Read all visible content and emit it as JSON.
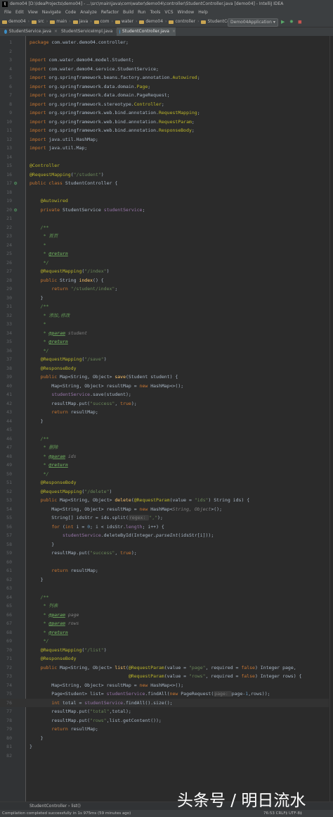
{
  "window": {
    "title": "demo04 [D:\\IdeaProjects\\demo04] - ...\\src\\main\\java\\com\\water\\demo04\\controller\\StudentController.java [demo04] - IntelliJ IDEA",
    "app_icon": "IJ"
  },
  "menu": [
    "File",
    "Edit",
    "View",
    "Navigate",
    "Code",
    "Analyze",
    "Refactor",
    "Build",
    "Run",
    "Tools",
    "VCS",
    "Window",
    "Help"
  ],
  "breadcrumbs": [
    "demo04",
    "src",
    "main",
    "java",
    "com",
    "water",
    "demo04",
    "controller",
    "StudentController"
  ],
  "toolbar": {
    "run_config": "Demo04Application ▾",
    "run_icon": "▶",
    "debug_icon": "✹",
    "coverage_icon": "◼"
  },
  "tabs": [
    {
      "label": "StudentService.java",
      "active": false
    },
    {
      "label": "StudentServiceImpl.java",
      "active": false
    },
    {
      "label": "StudentController.java",
      "active": true
    }
  ],
  "lines": [
    {
      "n": "1",
      "html": "<span class='kw'>package</span> com.water.demo04.controller;"
    },
    {
      "n": "2",
      "html": ""
    },
    {
      "n": "3",
      "html": "<span class='kw'>import</span> com.water.demo04.model.Student;"
    },
    {
      "n": "4",
      "html": "<span class='kw'>import</span> com.water.demo04.service.StudentService;"
    },
    {
      "n": "5",
      "html": "<span class='kw'>import</span> org.springframework.beans.factory.annotation.<span class='an'>Autowired</span>;"
    },
    {
      "n": "6",
      "html": "<span class='kw'>import</span> org.springframework.data.domain.<span class='an'>Page</span>;"
    },
    {
      "n": "7",
      "html": "<span class='kw'>import</span> org.springframework.data.domain.PageRequest;"
    },
    {
      "n": "8",
      "html": "<span class='kw'>import</span> org.springframework.stereotype.<span class='an'>Controller</span>;"
    },
    {
      "n": "9",
      "html": "<span class='kw'>import</span> org.springframework.web.bind.annotation.<span class='an'>RequestMapping</span>;"
    },
    {
      "n": "10",
      "html": "<span class='kw'>import</span> org.springframework.web.bind.annotation.<span class='an'>RequestParam</span>;"
    },
    {
      "n": "11",
      "html": "<span class='kw'>import</span> org.springframework.web.bind.annotation.<span class='an'>ResponseBody</span>;"
    },
    {
      "n": "12",
      "html": "<span class='kw'>import</span> java.util.HashMap;"
    },
    {
      "n": "13",
      "html": "<span class='kw'>import</span> java.util.Map;"
    },
    {
      "n": "14",
      "html": ""
    },
    {
      "n": "15",
      "html": "<span class='an'>@Controller</span>"
    },
    {
      "n": "16",
      "html": "<span class='an'>@RequestMapping</span>(<span class='st'>\"/student\"</span>)"
    },
    {
      "n": "17",
      "html": "<span class='kw'>public class</span> StudentController {",
      "gi": "bean"
    },
    {
      "n": "18",
      "html": ""
    },
    {
      "n": "19",
      "html": "    <span class='an'>@Autowired</span>"
    },
    {
      "n": "20",
      "html": "    <span class='kw'>private</span> StudentService <span class='fd'>studentService</span>;",
      "gi": "bean"
    },
    {
      "n": "21",
      "html": ""
    },
    {
      "n": "22",
      "html": "    <span class='cm'>/**</span>"
    },
    {
      "n": "23",
      "html": "    <span class='cm'> * 首页</span>"
    },
    {
      "n": "24",
      "html": "    <span class='cm'> *</span>"
    },
    {
      "n": "25",
      "html": "    <span class='cm'> * </span><span class='tag'>@return</span>"
    },
    {
      "n": "26",
      "html": "    <span class='cm'> */</span>"
    },
    {
      "n": "27",
      "html": "    <span class='an'>@RequestMapping</span>(<span class='st'>\"/index\"</span>)"
    },
    {
      "n": "28",
      "html": "    <span class='kw'>public</span> String <span class='fn'>index</span>() {"
    },
    {
      "n": "29",
      "html": "        <span class='kw'>return</span> <span class='st'>\"/student/index\"</span>;"
    },
    {
      "n": "30",
      "html": "    }"
    },
    {
      "n": "31",
      "html": "    <span class='cm'>/**</span>"
    },
    {
      "n": "32",
      "html": "    <span class='cm'> * 添加,修改</span>"
    },
    {
      "n": "33",
      "html": "    <span class='cm'> *</span>"
    },
    {
      "n": "34",
      "html": "    <span class='cm'> * </span><span class='tag'>@param</span> <span class='pn'>student</span>"
    },
    {
      "n": "35",
      "html": "    <span class='cm'> * </span><span class='tag'>@return</span>"
    },
    {
      "n": "36",
      "html": "    <span class='cm'> */</span>"
    },
    {
      "n": "37",
      "html": "    <span class='an'>@RequestMapping</span>(<span class='st'>\"/save\"</span>)"
    },
    {
      "n": "38",
      "html": "    <span class='an'>@ResponseBody</span>"
    },
    {
      "n": "39",
      "html": "    <span class='kw'>public</span> Map&lt;String, Object&gt; <span class='fn'>save</span>(Student student) {"
    },
    {
      "n": "40",
      "html": "        Map&lt;String, Object&gt; resultMap = <span class='kw'>new</span> HashMap&lt;&gt;();"
    },
    {
      "n": "41",
      "html": "        <span class='fd'>studentService</span>.save(student);"
    },
    {
      "n": "42",
      "html": "        resultMap.put(<span class='st'>\"success\"</span>, <span class='kw'>true</span>);"
    },
    {
      "n": "43",
      "html": "        <span class='kw'>return</span> resultMap;"
    },
    {
      "n": "44",
      "html": "    }"
    },
    {
      "n": "45",
      "html": ""
    },
    {
      "n": "46",
      "html": "    <span class='cm'>/**</span>"
    },
    {
      "n": "47",
      "html": "    <span class='cm'> * 删除</span>"
    },
    {
      "n": "48",
      "html": "    <span class='cm'> * </span><span class='tag'>@param</span> <span class='pn'>ids</span>"
    },
    {
      "n": "49",
      "html": "    <span class='cm'> * </span><span class='tag'>@return</span>"
    },
    {
      "n": "50",
      "html": "    <span class='cm'> */</span>"
    },
    {
      "n": "51",
      "html": "    <span class='an'>@ResponseBody</span>"
    },
    {
      "n": "52",
      "html": "    <span class='an'>@RequestMapping</span>(<span class='st'>\"/delete\"</span>)"
    },
    {
      "n": "53",
      "html": "    <span class='kw'>public</span> Map&lt;String, Object&gt; <span class='fn'>delete</span>(<span class='an'>@RequestParam</span>(value = <span class='st'>\"ids\"</span>) String ids) {"
    },
    {
      "n": "54",
      "html": "        Map&lt;String, Object&gt; resultMap = <span class='kw'>new</span> HashMap&lt;<span class='pn'>String, Object</span>&gt;();"
    },
    {
      "n": "55",
      "html": "        String[] idsStr = ids.split(<span class='hint'>regex: </span><span class='st'>\",\"</span>);"
    },
    {
      "n": "56",
      "html": "        <span class='kw'>for</span> (<span class='kw'>int</span> i = <span class='nm'>0</span>; i &lt; idsStr.<span class='fd'>length</span>; i++) {"
    },
    {
      "n": "57",
      "html": "            <span class='fd'>studentService</span>.deleteById(Integer.<span class='sm'>parseInt</span>(idsStr[i]));"
    },
    {
      "n": "58",
      "html": "        }"
    },
    {
      "n": "59",
      "html": "        resultMap.put(<span class='st'>\"success\"</span>, <span class='kw'>true</span>);"
    },
    {
      "n": "60",
      "html": ""
    },
    {
      "n": "61",
      "html": "        <span class='kw'>return</span> resultMap;"
    },
    {
      "n": "62",
      "html": "    }"
    },
    {
      "n": "63",
      "html": ""
    },
    {
      "n": "64",
      "html": "    <span class='cm'>/**</span>"
    },
    {
      "n": "65",
      "html": "    <span class='cm'> * 列表</span>"
    },
    {
      "n": "66",
      "html": "    <span class='cm'> * </span><span class='tag'>@param</span> <span class='pn'>page</span>"
    },
    {
      "n": "67",
      "html": "    <span class='cm'> * </span><span class='tag'>@param</span> <span class='pn'>rows</span>"
    },
    {
      "n": "68",
      "html": "    <span class='cm'> * </span><span class='tag'>@return</span>"
    },
    {
      "n": "69",
      "html": "    <span class='cm'> */</span>"
    },
    {
      "n": "70",
      "html": "    <span class='an'>@RequestMapping</span>(<span class='st'>\"/list\"</span>)"
    },
    {
      "n": "71",
      "html": "    <span class='an'>@ResponseBody</span>"
    },
    {
      "n": "72",
      "html": "    <span class='kw'>public</span> Map&lt;String, Object&gt; <span class='fn'>list</span>(<span class='an'>@RequestParam</span>(value = <span class='st'>\"page\"</span>, required = <span class='kw'>false</span>) Integer page,"
    },
    {
      "n": "73",
      "html": "                                    <span class='an'>@RequestParam</span>(value = <span class='st'>\"rows\"</span>, required = <span class='kw'>false</span>) Integer rows) {"
    },
    {
      "n": "74",
      "html": "        Map&lt;String, Object&gt; resultMap = <span class='kw'>new</span> HashMap&lt;&gt;();"
    },
    {
      "n": "75",
      "html": "        Page&lt;Student&gt; list= <span class='fd'>studentService</span>.findAll(<span class='kw'>new</span> PageRequest(<span class='hint'>page: </span>page-<span class='nm'>1</span>,rows));"
    },
    {
      "n": "76",
      "html": "        <span class='kw'>int</span> total = <span class='fd'>studentService</span>.findAll().size();",
      "hl": true
    },
    {
      "n": "77",
      "html": "        resultMap.put(<span class='st'>\"total\"</span>,total);"
    },
    {
      "n": "78",
      "html": "        resultMap.put(<span class='st'>\"rows\"</span>,list.getContent());"
    },
    {
      "n": "79",
      "html": "        <span class='kw'>return</span> resultMap;"
    },
    {
      "n": "80",
      "html": "    }"
    },
    {
      "n": "81",
      "html": "}"
    },
    {
      "n": "82",
      "html": ""
    }
  ],
  "footer_breadcrumb": "StudentController  ›  list()",
  "status": {
    "message": "Compilation completed successfully in 1s 975ms (59 minutes ago)",
    "right": "76:53   CRLF‡   UTF-8‡"
  },
  "watermark": "头条号 / 明日流水"
}
